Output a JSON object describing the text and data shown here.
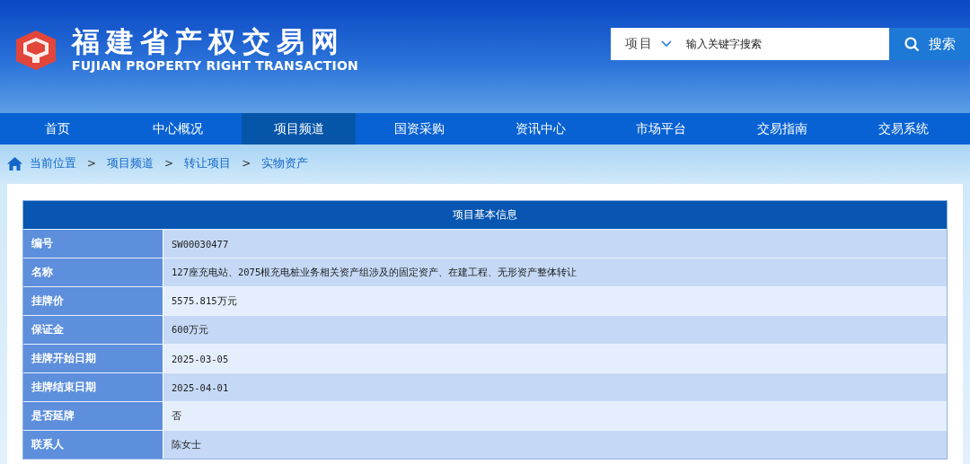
{
  "site": {
    "title": "福建省产权交易网",
    "subtitle": "FUJIAN PROPERTY RIGHT TRANSACTION"
  },
  "search": {
    "category": "项目",
    "placeholder": "输入关键字搜索",
    "button": "搜索"
  },
  "nav": [
    {
      "label": "首页",
      "selected": false
    },
    {
      "label": "中心概况",
      "selected": false
    },
    {
      "label": "项目频道",
      "selected": true
    },
    {
      "label": "国资采购",
      "selected": false
    },
    {
      "label": "资讯中心",
      "selected": false
    },
    {
      "label": "市场平台",
      "selected": false
    },
    {
      "label": "交易指南",
      "selected": false
    },
    {
      "label": "交易系统",
      "selected": false
    }
  ],
  "breadcrumb": {
    "label": "当前位置",
    "items": [
      "项目频道",
      "转让项目",
      "实物资产"
    ],
    "separator": ">"
  },
  "table": {
    "title": "项目基本信息",
    "rows": [
      {
        "label": "编号",
        "value": "SW00030477",
        "kind": "dark"
      },
      {
        "label": "名称",
        "value": "127座充电站、2075根充电桩业务相关资产组涉及的固定资产、在建工程、无形资产整体转让",
        "kind": "dark"
      },
      {
        "label": "挂牌价",
        "value": "5575.815万元",
        "kind": "light"
      },
      {
        "label": "保证金",
        "value": "600万元",
        "kind": "dark"
      },
      {
        "label": "挂牌开始日期",
        "value": "2025-03-05",
        "kind": "light"
      },
      {
        "label": "挂牌结束日期",
        "value": "2025-04-01",
        "kind": "dark"
      },
      {
        "label": "是否延牌",
        "value": "否",
        "kind": "light"
      },
      {
        "label": "联系人",
        "value": "陈女士",
        "kind": "dark"
      }
    ]
  }
}
